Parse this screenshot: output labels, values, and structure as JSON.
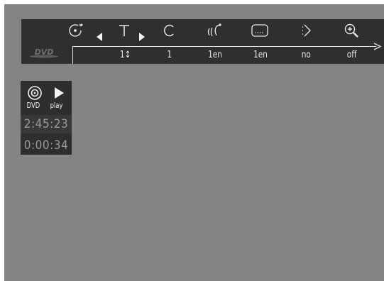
{
  "menu": {
    "items": [
      {
        "icon": "angle-icon",
        "value": ""
      },
      {
        "icon": "title-icon",
        "value": "1↕"
      },
      {
        "icon": "chapter-icon",
        "value": "1"
      },
      {
        "icon": "audio-icon",
        "value": "1en"
      },
      {
        "icon": "subtitle-icon",
        "value": "1en"
      },
      {
        "icon": "repeat-icon",
        "value": "no"
      },
      {
        "icon": "zoom-icon",
        "value": "off"
      }
    ],
    "logo_text": "DVD"
  },
  "status": {
    "disc_label": "DVD",
    "mode_label": "play",
    "total_time": "2:45:23",
    "elapsed_time": "0:00:34"
  },
  "colors": {
    "background": "#848484",
    "panel": "#2f2f2f",
    "text": "#eaeaea",
    "time_text": "#9a9a9a"
  }
}
